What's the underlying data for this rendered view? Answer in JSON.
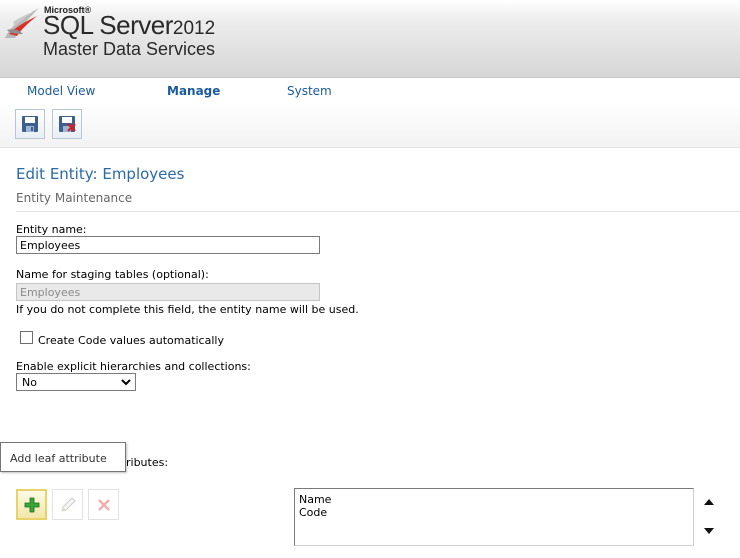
{
  "brand": {
    "company": "Microsoft®",
    "product": "SQL Server",
    "version": "2012",
    "subtitle": "Master Data Services"
  },
  "nav": {
    "items": [
      {
        "label": "Model View"
      },
      {
        "label": "Manage",
        "active": true
      },
      {
        "label": "System"
      }
    ]
  },
  "toolbar": {
    "save": {
      "icon": "save-icon"
    },
    "save_close": {
      "icon": "save-close-icon"
    }
  },
  "page": {
    "title": "Edit Entity: Employees",
    "subtitle": "Entity Maintenance"
  },
  "form": {
    "entity_name_label": "Entity name:",
    "entity_name_value": "Employees",
    "staging_label": "Name for staging tables (optional):",
    "staging_value": "Employees",
    "staging_help": "If you do not complete this field, the entity name will be used.",
    "create_code_label": "Create Code values automatically",
    "create_code_checked": false,
    "hierarchies_label": "Enable explicit hierarchies and collections:",
    "hierarchies_value": "No"
  },
  "attributes": {
    "label_visible_part": "ributes:",
    "tooltip": "Add leaf attribute",
    "items": [
      "Name",
      "Code"
    ],
    "add_icon": "plus-icon",
    "edit_icon": "pencil-icon",
    "delete_icon": "x-icon"
  },
  "colors": {
    "nav_text": "#1a5b9c",
    "title_text": "#2a6aa8",
    "add_button_border": "#e8d26a"
  }
}
